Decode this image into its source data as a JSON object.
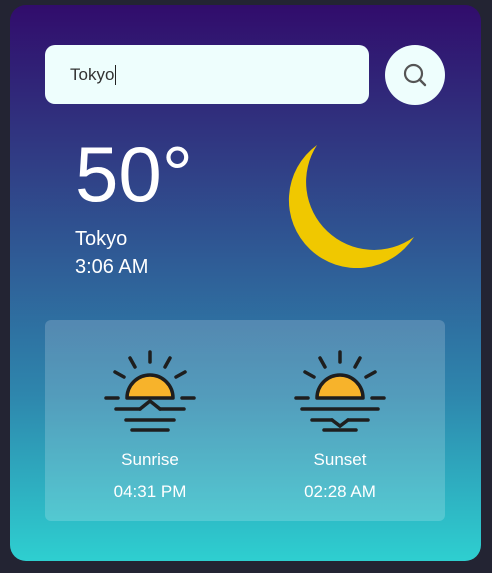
{
  "search": {
    "value": "Tokyo",
    "button_icon": "search-icon"
  },
  "weather": {
    "temperature": "50°",
    "city": "Tokyo",
    "local_time": "3:06 AM",
    "condition_icon": "moon-icon",
    "moon_color": "#f0c800"
  },
  "sun": {
    "sunrise_label": "Sunrise",
    "sunrise_time": "04:31 PM",
    "sunset_label": "Sunset",
    "sunset_time": "02:28 AM",
    "sunrise_icon": "sunrise-icon",
    "sunset_icon": "sunset-icon",
    "sun_color": "#f7b32b"
  }
}
